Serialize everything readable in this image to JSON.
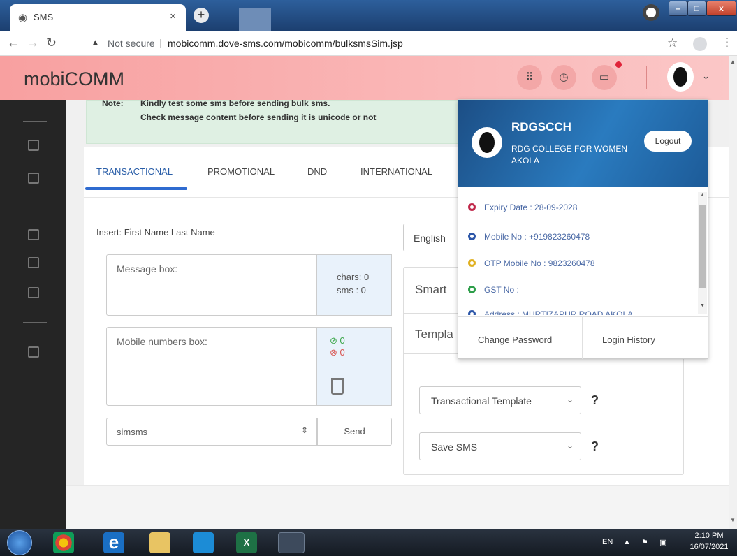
{
  "browser": {
    "tab_title": "SMS",
    "new_tab": "+",
    "tab_close": "×",
    "not_secure": "Not secure",
    "url": "mobicomm.dove-sms.com/mobicomm/bulksmsSim.jsp"
  },
  "app": {
    "brand": "mobiCOMM"
  },
  "note": {
    "label": "Note:",
    "line1": "Kindly test some sms before sending bulk sms.",
    "line2": "Check message content before sending it is unicode or not"
  },
  "tabs": [
    "TRANSACTIONAL",
    "PROMOTIONAL",
    "DND",
    "INTERNATIONAL"
  ],
  "compose": {
    "insert_label": "Insert: First Name Last Name",
    "message_placeholder": "Message box:",
    "chars": "chars: 0",
    "sms": "sms : 0",
    "mobile_placeholder": "Mobile numbers box:",
    "valid_count": "0",
    "invalid_count": "0",
    "sim_select": "simsms",
    "send": "Send",
    "language": "English"
  },
  "right_panel": {
    "smart_label": "Smart",
    "template_label": "Templa",
    "template_select": "Transactional Template",
    "save_select": "Save SMS",
    "help": "?"
  },
  "profile": {
    "name": "RDGSCCH",
    "org_line1": "RDG COLLEGE FOR WOMEN",
    "org_line2": "AKOLA",
    "logout": "Logout",
    "details": [
      {
        "text": "Expiry Date : 28-09-2028",
        "color": "#c0284a"
      },
      {
        "text": "Mobile No : +919823260478",
        "color": "#2c56a8"
      },
      {
        "text": "OTP Mobile No : 9823260478",
        "color": "#e0b020"
      },
      {
        "text": "GST No :",
        "color": "#2e9e4a"
      },
      {
        "text": "Address : MURTIZAPUR ROAD AKOLA",
        "color": "#2c56a8"
      }
    ],
    "change_password": "Change Password",
    "login_history": "Login History"
  },
  "taskbar": {
    "lang": "EN",
    "time": "2:10 PM",
    "date": "16/07/2021"
  }
}
